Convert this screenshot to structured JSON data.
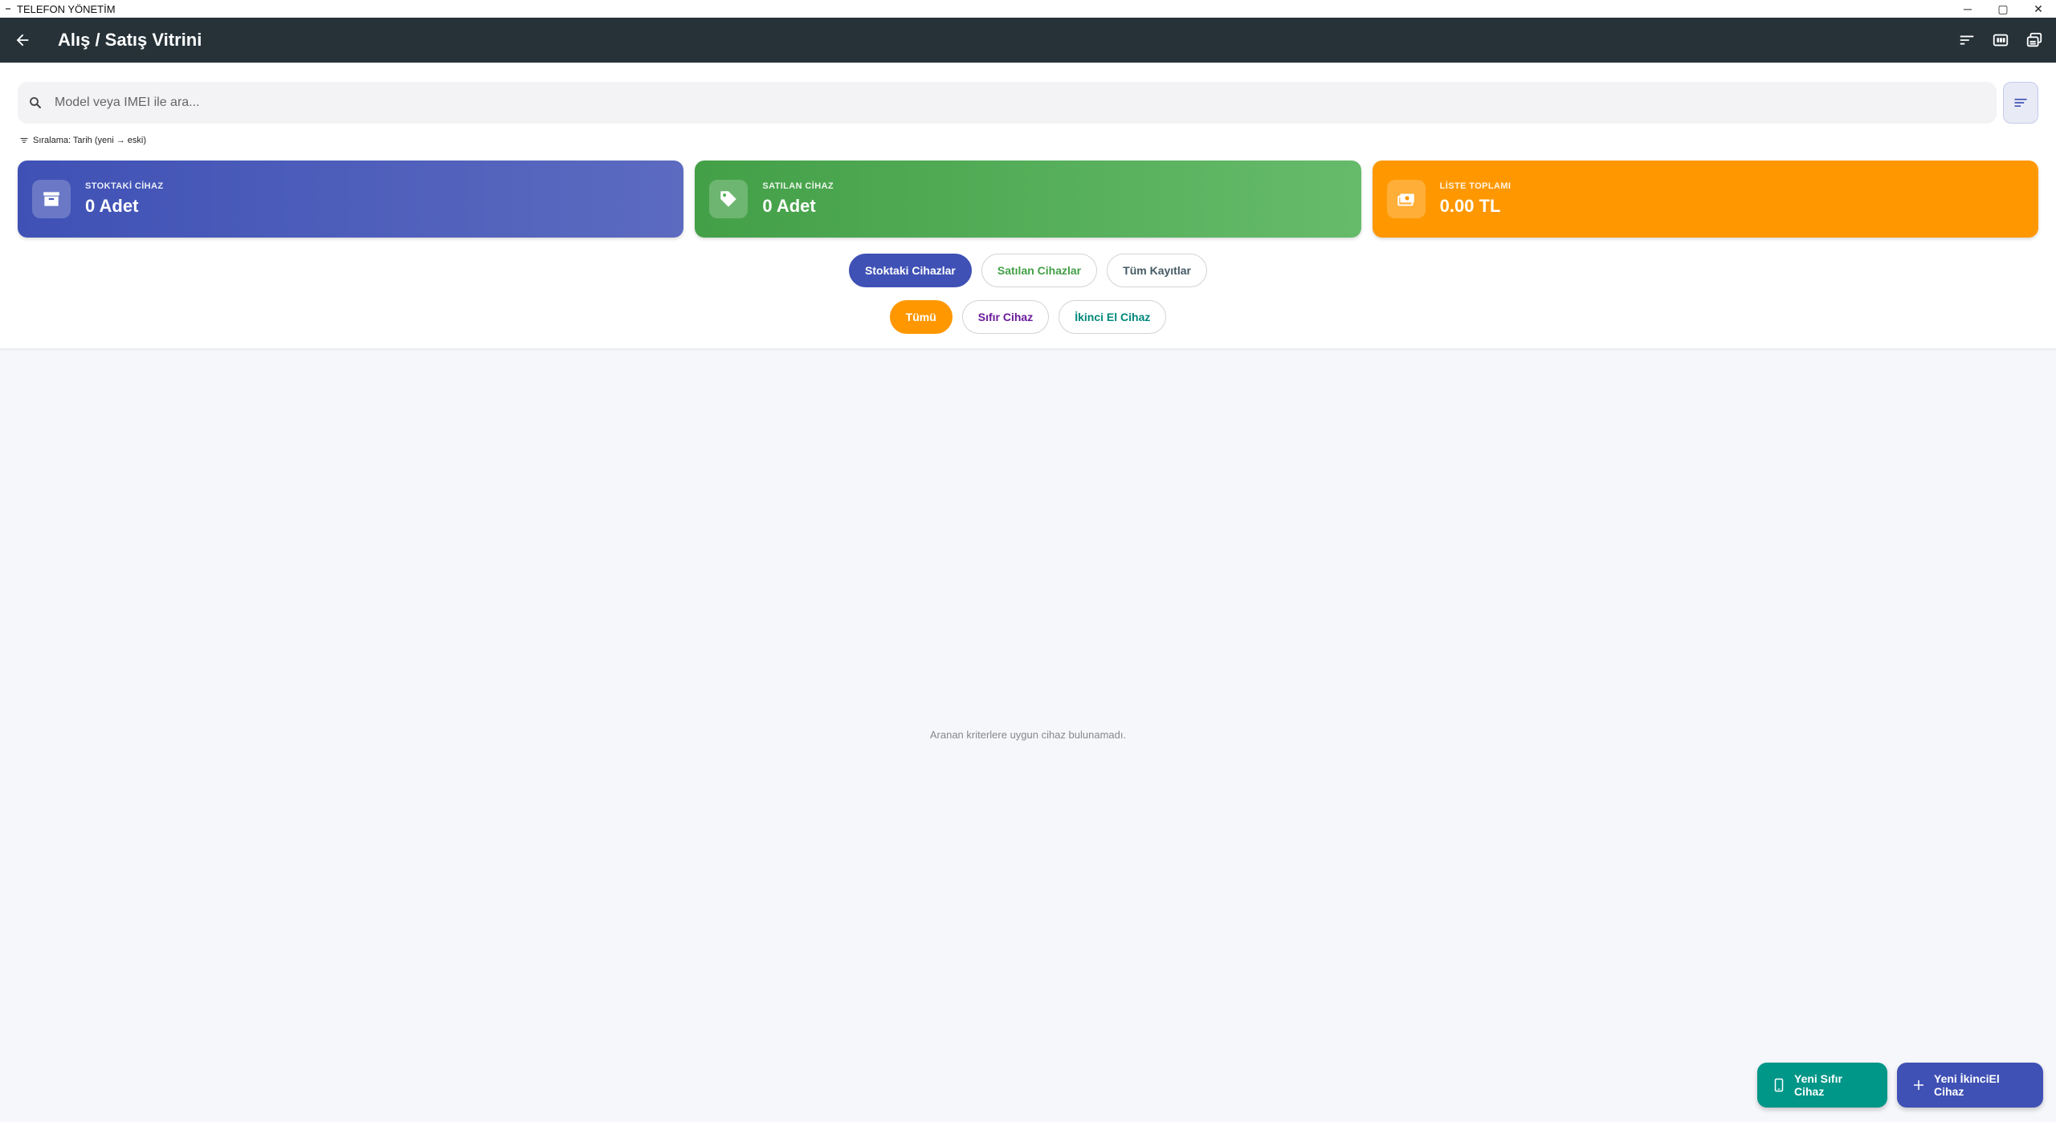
{
  "window": {
    "title": "TELEFON YÖNETİM",
    "controls": {
      "minimize": "─",
      "maximize": "▢",
      "close": "✕"
    }
  },
  "appbar": {
    "title": "Alış / Satış Vitrini",
    "icons": [
      "back-arrow-icon",
      "sort-icon",
      "gallery-icon",
      "multi-window-icon"
    ]
  },
  "search": {
    "placeholder": "Model veya IMEI ile ara..."
  },
  "sort": {
    "label": "Sıralama: Tarih (yeni → eski)"
  },
  "cards": [
    {
      "label": "STOKTAKİ CİHAZ",
      "value": "0 Adet",
      "icon": "inventory-icon",
      "color": "#3f51b5"
    },
    {
      "label": "SATILAN CİHAZ",
      "value": "0 Adet",
      "icon": "tag-icon",
      "color": "#43a047"
    },
    {
      "label": "LİSTE TOPLAMI",
      "value": "0.00 TL",
      "icon": "money-icon",
      "color": "#ff9800"
    }
  ],
  "status_filters": {
    "selected": "Stoktaki Cihazlar",
    "options": [
      "Stoktaki Cihazlar",
      "Satılan Cihazlar",
      "Tüm Kayıtlar"
    ]
  },
  "type_filters": {
    "selected": "Tümü",
    "options": [
      "Tümü",
      "Sıfır Cihaz",
      "İkinci El Cihaz"
    ]
  },
  "empty_message": "Aranan kriterlere uygun cihaz bulunamadı.",
  "fabs": {
    "new_device": "Yeni Sıfır Cihaz",
    "used_device": "Yeni İkinciEl Cihaz"
  },
  "colors": {
    "appbar": "#263238",
    "primary": "#3f51b5",
    "success": "#43a047",
    "accent": "#ff9800",
    "teal": "#009688",
    "purple": "#6a1b9a"
  }
}
